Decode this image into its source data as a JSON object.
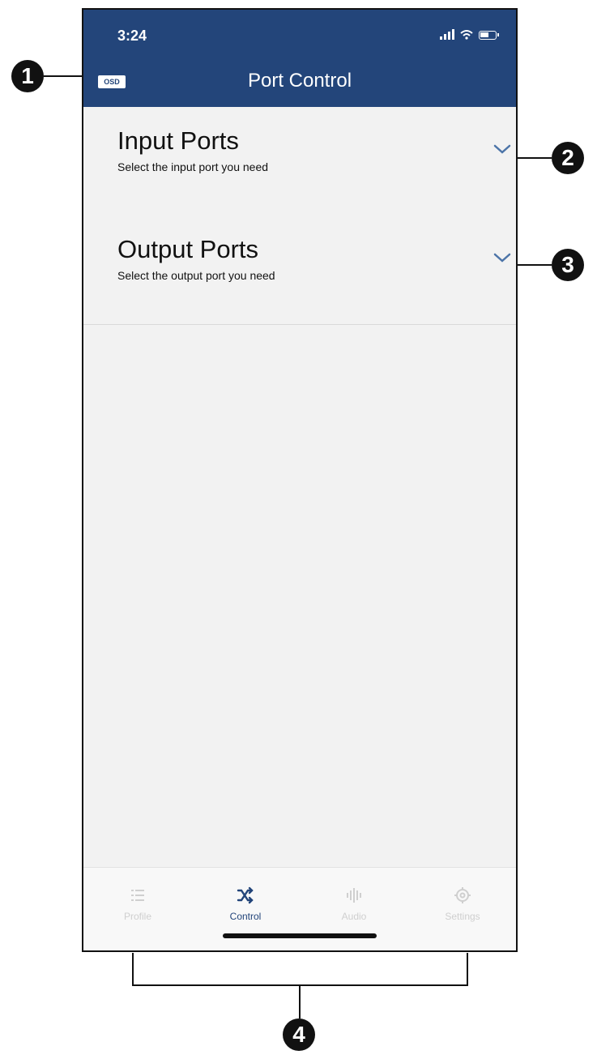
{
  "status": {
    "time": "3:24"
  },
  "header": {
    "osd_label": "OSD",
    "title": "Port Control"
  },
  "sections": [
    {
      "title": "Input Ports",
      "subtitle": "Select the input port you need"
    },
    {
      "title": "Output Ports",
      "subtitle": "Select the output port you need"
    }
  ],
  "tabs": [
    {
      "label": "Profile",
      "icon": "list-icon",
      "active": false
    },
    {
      "label": "Control",
      "icon": "shuffle-icon",
      "active": true
    },
    {
      "label": "Audio",
      "icon": "audio-wave-icon",
      "active": false
    },
    {
      "label": "Settings",
      "icon": "gear-icon",
      "active": false
    }
  ],
  "callouts": [
    "1",
    "2",
    "3",
    "4"
  ],
  "colors": {
    "header": "#23457a",
    "background": "#f2f2f2",
    "accent": "#23457a",
    "inactive": "#cfcfcf"
  }
}
